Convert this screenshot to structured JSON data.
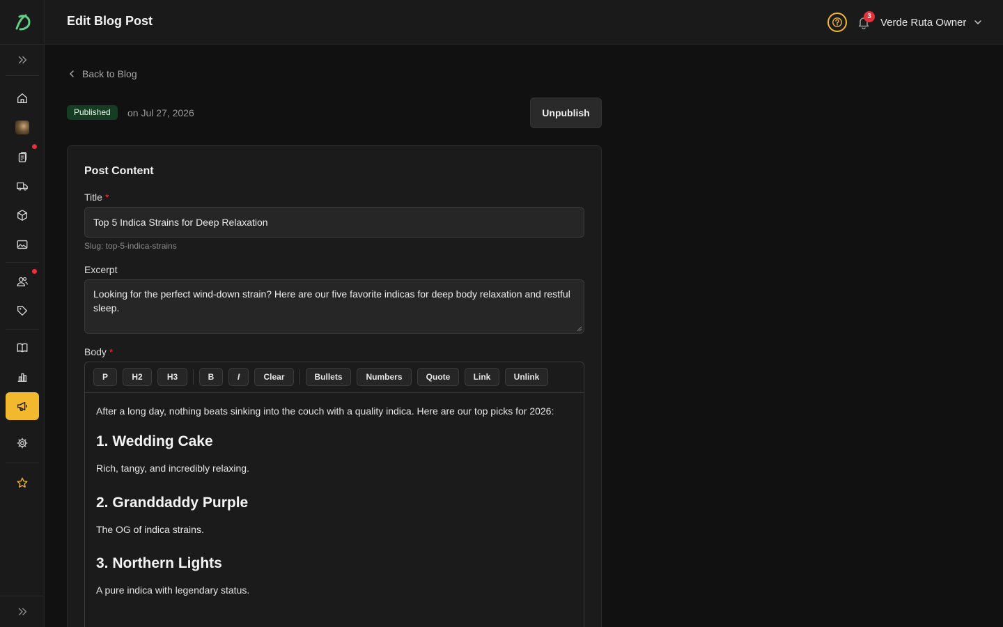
{
  "app": {
    "page_title": "Edit Blog Post"
  },
  "header": {
    "notification_count": "3",
    "user_name": "Verde Ruta Owner"
  },
  "sidebar": {
    "items": [
      {
        "icon": "home-icon"
      },
      {
        "icon": "store-avatar"
      },
      {
        "icon": "orders-icon",
        "dot": true
      },
      {
        "icon": "delivery-truck-icon"
      },
      {
        "icon": "package-icon"
      },
      {
        "icon": "media-icon"
      },
      {
        "icon": "customers-icon",
        "dot": true
      },
      {
        "icon": "tag-icon"
      },
      {
        "icon": "book-icon"
      },
      {
        "icon": "analytics-icon"
      },
      {
        "icon": "megaphone-icon",
        "active": true
      },
      {
        "icon": "settings-icon"
      },
      {
        "icon": "star-icon"
      }
    ],
    "active_color": "#f2b92f"
  },
  "nav": {
    "back_label": "Back to Blog"
  },
  "status": {
    "badge": "Published",
    "date_text": "on Jul 27, 2026",
    "unpublish_label": "Unpublish"
  },
  "form": {
    "section_title": "Post Content",
    "title_label": "Title",
    "title_value": "Top 5 Indica Strains for Deep Relaxation",
    "required_mark": "*",
    "slug_text": "Slug: top-5-indica-strains",
    "excerpt_label": "Excerpt",
    "excerpt_value": "Looking for the perfect wind-down strain? Here are our five favorite indicas for deep body relaxation and restful sleep.",
    "body_label": "Body"
  },
  "toolbar": {
    "buttons": [
      "P",
      "H2",
      "H3",
      "B",
      "I",
      "Clear",
      "Bullets",
      "Numbers",
      "Quote",
      "Link",
      "Unlink"
    ]
  },
  "body_content": {
    "intro": "After a long day, nothing beats sinking into the couch with a quality indica. Here are our top picks for 2026:",
    "h1": "1. Wedding Cake",
    "p1": "Rich, tangy, and incredibly relaxing.",
    "h2": "2. Granddaddy Purple",
    "p2": "The OG of indica strains.",
    "h3": "3. Northern Lights",
    "p3": "A pure indica with legendary status."
  }
}
